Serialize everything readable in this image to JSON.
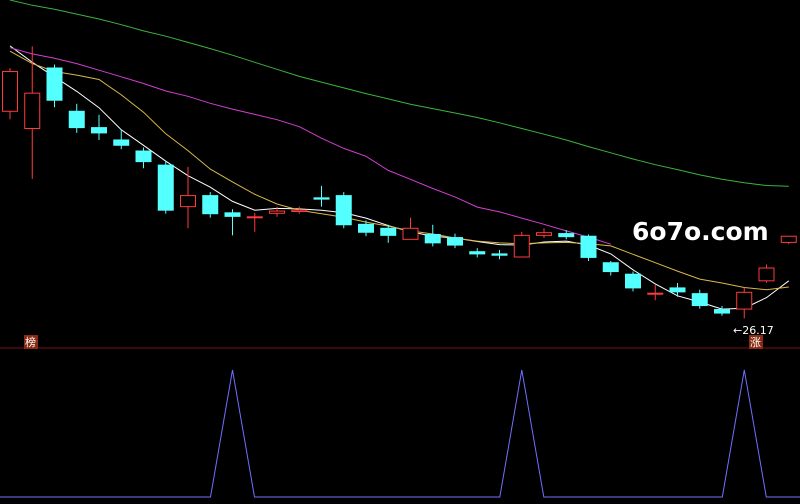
{
  "watermark": "6o7o.com",
  "low_label": "←26.17",
  "markers": {
    "left": "榜",
    "right": "涨"
  },
  "colors": {
    "bg": "#000000",
    "up": "#ff3b3b",
    "down": "#54ffff",
    "ma_white": "#ffffff",
    "ma_yellow": "#d9b84a",
    "ma_magenta": "#d23fd2",
    "ma_green": "#3cb43c",
    "indicator": "#6f6fff",
    "divider": "#7a1010",
    "marker_bg": "#8a2a10",
    "marker_fg": "#ffffff"
  },
  "chart_data": [
    {
      "type": "candlestick",
      "yscale": {
        "min": 25.55,
        "max": 33.25
      },
      "candles": [
        {
          "open": 30.73,
          "close": 31.63,
          "high": 31.71,
          "low": 30.55
        },
        {
          "open": 30.34,
          "close": 31.14,
          "high": 32.2,
          "low": 29.2
        },
        {
          "open": 31.71,
          "close": 30.98,
          "high": 31.79,
          "low": 30.82
        },
        {
          "open": 30.73,
          "close": 30.36,
          "high": 30.9,
          "low": 30.24
        },
        {
          "open": 30.36,
          "close": 30.24,
          "high": 30.65,
          "low": 30.08
        },
        {
          "open": 30.08,
          "close": 29.96,
          "high": 30.32,
          "low": 29.87
        },
        {
          "open": 29.83,
          "close": 29.59,
          "high": 29.91,
          "low": 29.44
        },
        {
          "open": 29.51,
          "close": 28.49,
          "high": 29.59,
          "low": 28.41
        },
        {
          "open": 28.57,
          "close": 28.82,
          "high": 29.47,
          "low": 28.08
        },
        {
          "open": 28.82,
          "close": 28.41,
          "high": 28.9,
          "low": 28.32
        },
        {
          "open": 28.43,
          "close": 28.35,
          "high": 28.51,
          "low": 27.92
        },
        {
          "open": 28.32,
          "close": 28.34,
          "high": 28.43,
          "low": 28.0
        },
        {
          "open": 28.42,
          "close": 28.47,
          "high": 28.57,
          "low": 28.34
        },
        {
          "open": 28.46,
          "close": 28.49,
          "high": 28.57,
          "low": 28.41
        },
        {
          "open": 28.77,
          "close": 28.74,
          "high": 29.04,
          "low": 28.57
        },
        {
          "open": 28.82,
          "close": 28.16,
          "high": 28.9,
          "low": 28.08
        },
        {
          "open": 28.17,
          "close": 27.99,
          "high": 28.26,
          "low": 27.9
        },
        {
          "open": 28.08,
          "close": 27.92,
          "high": 28.16,
          "low": 27.75
        },
        {
          "open": 27.83,
          "close": 28.08,
          "high": 28.32,
          "low": 27.83
        },
        {
          "open": 27.94,
          "close": 27.75,
          "high": 28.16,
          "low": 27.67
        },
        {
          "open": 27.87,
          "close": 27.7,
          "high": 27.96,
          "low": 27.63
        },
        {
          "open": 27.55,
          "close": 27.5,
          "high": 27.63,
          "low": 27.42
        },
        {
          "open": 27.5,
          "close": 27.47,
          "high": 27.59,
          "low": 27.38
        },
        {
          "open": 27.43,
          "close": 27.92,
          "high": 28.0,
          "low": 27.43
        },
        {
          "open": 27.92,
          "close": 27.98,
          "high": 28.08,
          "low": 27.86
        },
        {
          "open": 27.96,
          "close": 27.89,
          "high": 28.04,
          "low": 27.83
        },
        {
          "open": 27.9,
          "close": 27.42,
          "high": 27.94,
          "low": 27.34
        },
        {
          "open": 27.3,
          "close": 27.1,
          "high": 27.34,
          "low": 27.01
        },
        {
          "open": 27.04,
          "close": 26.73,
          "high": 27.1,
          "low": 26.65
        },
        {
          "open": 26.59,
          "close": 26.61,
          "high": 26.8,
          "low": 26.45
        },
        {
          "open": 26.73,
          "close": 26.64,
          "high": 26.84,
          "low": 26.53
        },
        {
          "open": 26.6,
          "close": 26.33,
          "high": 26.69,
          "low": 26.26
        },
        {
          "open": 26.24,
          "close": 26.16,
          "high": 26.32,
          "low": 26.1
        },
        {
          "open": 26.25,
          "close": 26.63,
          "high": 26.73,
          "low": 26.04
        },
        {
          "open": 26.89,
          "close": 27.18,
          "high": 27.26,
          "low": 26.85
        },
        {
          "open": 27.76,
          "close": 27.9,
          "high": 27.9,
          "low": 27.72
        }
      ],
      "moving_averages": [
        {
          "color_key": "ma_white",
          "values": [
            32.21,
            31.84,
            31.51,
            31.18,
            30.81,
            30.31,
            29.96,
            29.6,
            29.27,
            29.01,
            28.69,
            28.49,
            28.53,
            28.52,
            28.49,
            28.43,
            28.31,
            28.14,
            28.0,
            27.9,
            27.86,
            27.78,
            27.71,
            27.7,
            27.77,
            27.79,
            27.7,
            27.5,
            27.14,
            26.82,
            26.55,
            26.41,
            26.25,
            26.27,
            26.51,
            26.89
          ]
        },
        {
          "color_key": "ma_yellow",
          "values": [
            32.09,
            31.81,
            31.63,
            31.55,
            31.45,
            31.1,
            30.71,
            30.22,
            29.84,
            29.42,
            29.13,
            28.85,
            28.63,
            28.49,
            28.41,
            28.33,
            28.22,
            28.13,
            28.02,
            27.95,
            27.86,
            27.79,
            27.75,
            27.73,
            27.75,
            27.76,
            27.73,
            27.68,
            27.49,
            27.3,
            27.11,
            26.93,
            26.84,
            26.74,
            26.69,
            26.75
          ]
        },
        {
          "color_key": "ma_magenta",
          "values": [
            32.17,
            32.03,
            31.93,
            31.81,
            31.66,
            31.51,
            31.36,
            31.19,
            31.07,
            30.91,
            30.78,
            30.66,
            30.54,
            30.38,
            30.12,
            29.89,
            29.71,
            29.39,
            29.19,
            28.98,
            28.79,
            28.56,
            28.45,
            28.31,
            28.17,
            28.02,
            27.88,
            27.72
          ]
        },
        {
          "color_key": "ma_green",
          "values": [
            33.25,
            33.13,
            33.04,
            32.93,
            32.82,
            32.69,
            32.55,
            32.43,
            32.29,
            32.15,
            32.0,
            31.84,
            31.68,
            31.52,
            31.39,
            31.26,
            31.13,
            31.01,
            30.89,
            30.79,
            30.69,
            30.59,
            30.47,
            30.34,
            30.21,
            30.08,
            29.93,
            29.79,
            29.65,
            29.52,
            29.41,
            29.29,
            29.19,
            29.11,
            29.05,
            29.03
          ]
        }
      ]
    },
    {
      "type": "line",
      "series": [
        {
          "x": [
            0,
            1,
            2,
            3,
            4,
            5,
            6,
            7,
            8,
            9,
            10,
            11,
            12,
            13,
            14,
            15,
            16,
            17,
            18,
            19,
            20,
            21,
            22,
            23,
            24,
            25,
            26,
            27,
            28,
            29,
            30,
            31,
            32,
            33,
            34,
            35
          ],
          "values": [
            0,
            0,
            0,
            0,
            0,
            0,
            0,
            0,
            0,
            0,
            1,
            0,
            0,
            0,
            0,
            0,
            0,
            0,
            0,
            0,
            0,
            0,
            0,
            1,
            0,
            0,
            0,
            0,
            0,
            0,
            0,
            0,
            0,
            1,
            0,
            0
          ]
        }
      ],
      "ylim": [
        0,
        1
      ]
    }
  ]
}
